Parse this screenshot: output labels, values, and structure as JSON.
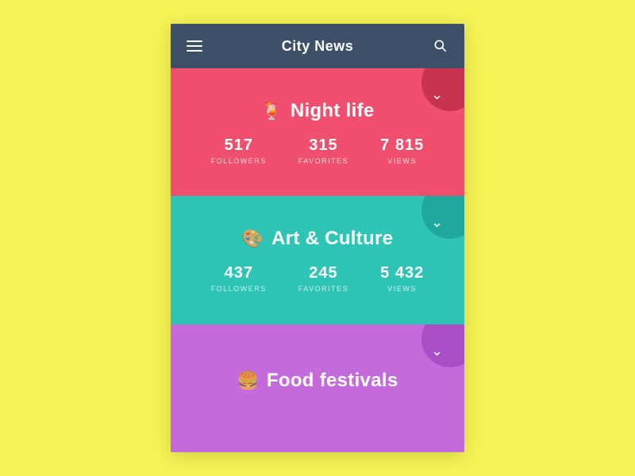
{
  "header": {
    "title": "City News"
  },
  "cards": [
    {
      "id": "nightlife",
      "icon": "🍹",
      "title": "Night life",
      "color": "#f0506e",
      "chevronColor": "#c8334f",
      "stats": [
        {
          "value": "517",
          "label": "FOLLOWERS"
        },
        {
          "value": "315",
          "label": "FAVORITES"
        },
        {
          "value": "7 815",
          "label": "VIEWS"
        }
      ]
    },
    {
      "id": "artculture",
      "icon": "🎨",
      "title": "Art & Culture",
      "color": "#2ec4b6",
      "chevronColor": "#20a89e",
      "stats": [
        {
          "value": "437",
          "label": "FOLLOWERS"
        },
        {
          "value": "245",
          "label": "FAVORITES"
        },
        {
          "value": "5 432",
          "label": "VIEWS"
        }
      ]
    },
    {
      "id": "food",
      "icon": "🍔",
      "title": "Food festivals",
      "color": "#c36bdb",
      "chevronColor": "#a94ec4",
      "stats": []
    }
  ]
}
